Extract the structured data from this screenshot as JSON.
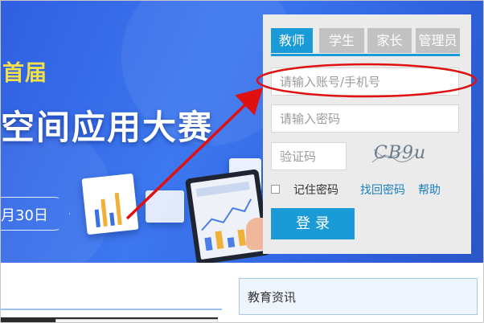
{
  "banner": {
    "subtitle": "首届",
    "title": "空间应用大赛",
    "date_text": "月30日"
  },
  "login": {
    "tabs": [
      {
        "label": "教师",
        "active": true
      },
      {
        "label": "学生",
        "active": false
      },
      {
        "label": "家长",
        "active": false
      },
      {
        "label": "管理员",
        "active": false
      }
    ],
    "account_placeholder": "请输入账号/手机号",
    "password_placeholder": "请输入密码",
    "captcha_placeholder": "验证码",
    "captcha_image_text": "CB9u",
    "remember_label": "记住密码",
    "forgot_link": "找回密码",
    "help_link": "帮助",
    "submit_label": "登录"
  },
  "news": {
    "title": "教育资讯"
  },
  "colors": {
    "accent": "#1a9ad6",
    "tab_inactive": "#c2c2c2",
    "annotation": "#e01010",
    "banner_yellow": "#f2e04a"
  }
}
